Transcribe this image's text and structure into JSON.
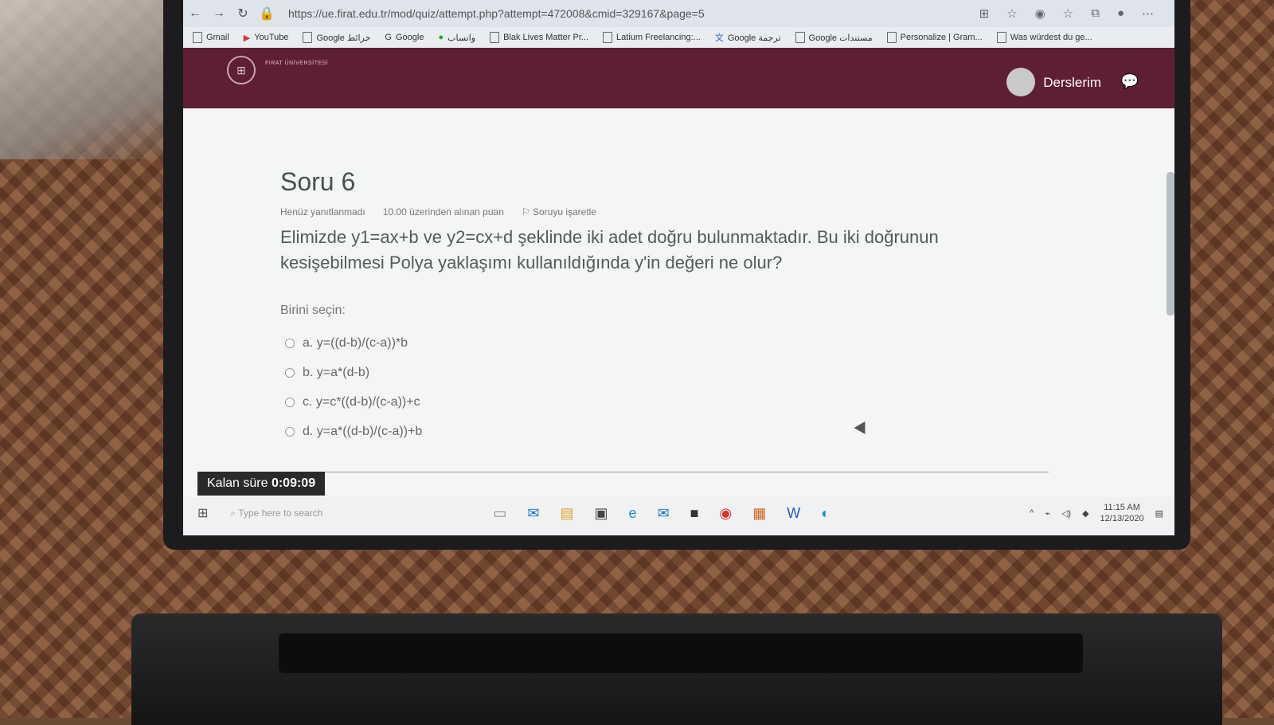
{
  "browser": {
    "url": "https://ue.firat.edu.tr/mod/quiz/attempt.php?attempt=472008&cmid=329167&page=5",
    "bookmarks": [
      "Gmail",
      "YouTube",
      "Google خرائط",
      "Google",
      "واتساب",
      "Blak Lives Matter Pr...",
      "Latium Freelancing:...",
      "Google ترجمة",
      "Google مستندات",
      "Personalize | Gram...",
      "Was würdest du ge..."
    ]
  },
  "header": {
    "logo_text": "FIRAT ÜNİVERSİTESİ",
    "my_courses": "Derslerim"
  },
  "question": {
    "title": "Soru 6",
    "status": "Henüz yanıtlanmadı",
    "points": "10.00 üzerinden alınan puan",
    "flag": "Soruyu işaretle",
    "text": "Elimizde y1=ax+b ve y2=cx+d şeklinde iki adet doğru bulunmaktadır. Bu iki doğrunun kesişebilmesi Polya yaklaşımı kullanıldığında y'in değeri ne olur?",
    "prompt": "Birini seçin:",
    "options": [
      "a. y=((d-b)/(c-a))*b",
      "b. y=a*(d-b)",
      "c. y=c*((d-b)/(c-a))+c",
      "d. y=a*((d-b)/(c-a))+b"
    ]
  },
  "timer": {
    "label": "Kalan süre",
    "value": "0:09:09"
  },
  "taskbar": {
    "search_placeholder": "Type here to search",
    "time": "11:15 AM",
    "date": "12/13/2020"
  }
}
